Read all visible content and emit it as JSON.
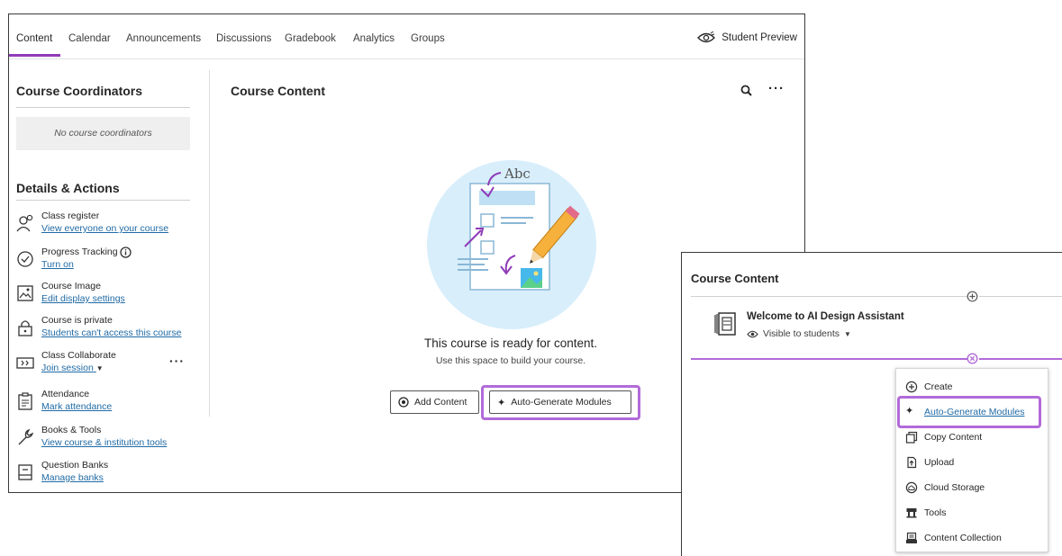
{
  "main": {
    "tabs": [
      {
        "label": "Content",
        "active": true
      },
      {
        "label": "Calendar"
      },
      {
        "label": "Announcements"
      },
      {
        "label": "Discussions"
      },
      {
        "label": "Gradebook"
      },
      {
        "label": "Analytics"
      },
      {
        "label": "Groups"
      }
    ],
    "student_preview_label": "Student Preview",
    "sidebar": {
      "coordinators_title": "Course Coordinators",
      "no_coordinators": "No course coordinators",
      "details_title": "Details & Actions",
      "items": [
        {
          "label": "Class register",
          "link": "View everyone on your course",
          "icon": "people-icon"
        },
        {
          "label": "Progress Tracking",
          "link": "Turn on",
          "icon": "check-circle-icon"
        },
        {
          "label": "Course Image",
          "link": "Edit display settings",
          "icon": "image-icon"
        },
        {
          "label": "Course is private",
          "link": "Students can't access this course",
          "icon": "lock-icon"
        },
        {
          "label": "Class Collaborate",
          "link": "Join session",
          "icon": "collaborate-icon"
        },
        {
          "label": "Attendance",
          "link": "Mark attendance",
          "icon": "attendance-icon"
        },
        {
          "label": "Books & Tools",
          "link": "View course & institution tools",
          "icon": "wrench-icon"
        },
        {
          "label": "Question Banks",
          "link": "Manage banks",
          "icon": "question-bank-icon"
        }
      ]
    },
    "content": {
      "title": "Course Content",
      "illustration_text": "Abc",
      "ready_title": "This course is ready for content.",
      "ready_subtitle": "Use this space to build your course.",
      "add_content_label": "Add Content",
      "auto_generate_label": "Auto-Generate Modules"
    }
  },
  "overlay": {
    "title": "Course Content",
    "item_title": "Welcome to AI Design Assistant",
    "visibility": "Visible to students",
    "menu": [
      {
        "label": "Create",
        "icon": "plus-circle-icon"
      },
      {
        "label": "Auto-Generate Modules",
        "icon": "sparkle-icon",
        "highlighted": true
      },
      {
        "label": "Copy Content",
        "icon": "copy-icon"
      },
      {
        "label": "Upload",
        "icon": "upload-icon"
      },
      {
        "label": "Cloud Storage",
        "icon": "cloud-icon"
      },
      {
        "label": "Tools",
        "icon": "tools-icon"
      },
      {
        "label": "Content Collection",
        "icon": "content-collection-icon"
      }
    ]
  },
  "colors": {
    "accent_purple": "#8f3bb8",
    "highlight_purple": "#b26ad9",
    "link_blue": "#1f6aa5",
    "illustration_bg": "#d8eefb"
  }
}
